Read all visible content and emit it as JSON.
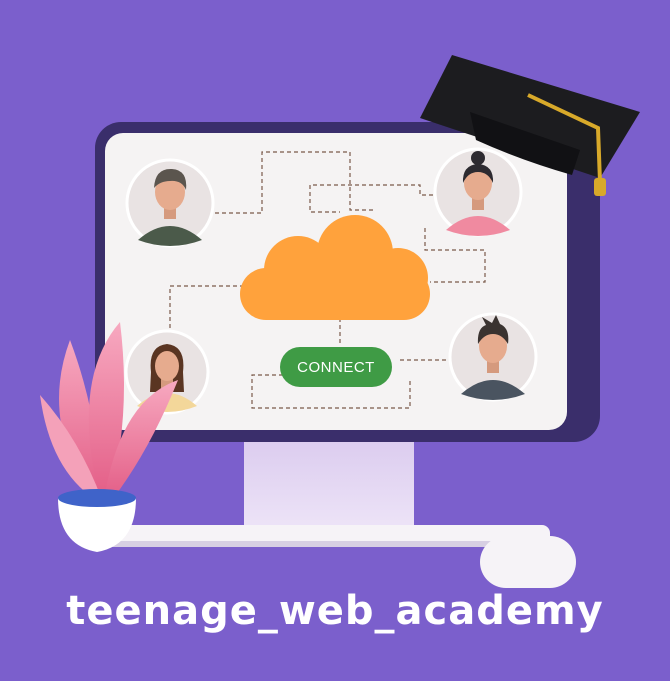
{
  "background_color": "#7b5fcc",
  "caption": {
    "text": "teenage_web_academy"
  },
  "illustration": {
    "connect_button": {
      "label": "CONNECT",
      "color": "#3f9b45"
    },
    "cloud": {
      "color": "#ffa23c"
    },
    "avatars": [
      {
        "name": "man-short-hair",
        "shirt_color": "#4b5a4a"
      },
      {
        "name": "woman-bun",
        "shirt_color": "#f08aa0"
      },
      {
        "name": "woman-long-hair",
        "shirt_color": "#f3d79a"
      },
      {
        "name": "man-spiky-hair",
        "shirt_color": "#4a5460"
      }
    ],
    "icons": [
      "graduation-cap-icon",
      "plant-icon",
      "keyboard-icon",
      "mouse-icon",
      "monitor-icon"
    ]
  }
}
